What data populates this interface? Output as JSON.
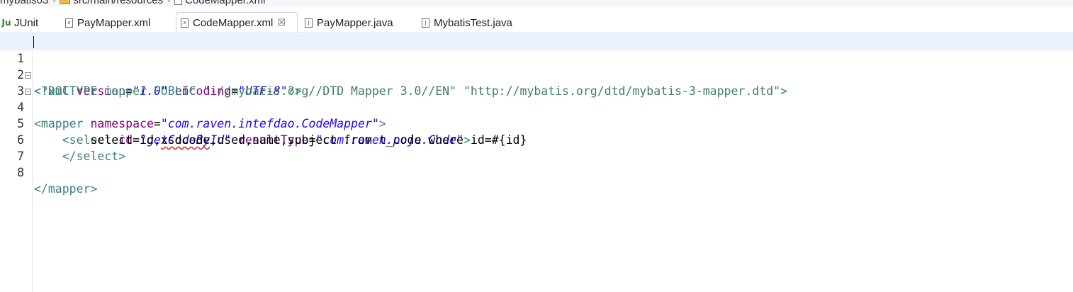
{
  "breadcrumb": {
    "items": [
      "mybatis03",
      "src/main/resources",
      "CodeMapper.xml"
    ]
  },
  "tabs": [
    {
      "label": "JUnit",
      "icon": "junit-icon",
      "active": false
    },
    {
      "label": "PayMapper.xml",
      "icon": "xml-file-icon",
      "active": false
    },
    {
      "label": "CodeMapper.xml",
      "icon": "xml-file-icon",
      "active": true,
      "close": "☒"
    },
    {
      "label": "PayMapper.java",
      "icon": "java-file-icon",
      "active": false
    },
    {
      "label": "MybatisTest.java",
      "icon": "java-file-icon",
      "active": false
    }
  ],
  "icon_glyphs": {
    "xml": "x",
    "java": "J",
    "junit": "Ju"
  },
  "editor": {
    "line_numbers": [
      "1",
      "2",
      "3",
      "4",
      "5",
      "6",
      "7",
      "8"
    ],
    "lines": {
      "l1": {
        "p1": "<?xml ",
        "p2": "version",
        "p3": "=",
        "p4": "\"1.0\"",
        "p5": " ",
        "p6": "encoding",
        "p7": "=",
        "p8": "\"UTF-8\"",
        "p9": "?>"
      },
      "l2": {
        "p1": "<!DOCTYPE mapper PUBLIC ",
        "p2": "\"-//mybatis.org//DTD Mapper 3.0//EN\"",
        "p3": " ",
        "p4": "\"http://mybatis.org/dtd/mybatis-3-mapper.dtd\"",
        "p5": ">"
      },
      "l3": {
        "p1": "<mapper ",
        "p2": "namespace",
        "p3": "=",
        "p4": "\"com.raven.intefdao.CodeMapper\"",
        "p5": ">"
      },
      "l4": {
        "p0": "    ",
        "p1": "<select ",
        "p2": "id",
        "p3": "=",
        "p4": "\"getCodeById\"",
        "p5": " ",
        "p6": "resultType",
        "p7": "=",
        "p8": "\"com.raven.pojo.Code\"",
        "p9": ">"
      },
      "l5": {
        "p1": "        select id,",
        "p2": "xsdcode",
        "p3": ",used,name,subject from t_code where id=#{id}"
      },
      "l6": {
        "p0": "    ",
        "p1": "</select>"
      },
      "l7": {
        "p1": ""
      },
      "l8": {
        "p1": "</mapper>"
      }
    },
    "fold_markers": {
      "l3": "⊖",
      "l4": "⊖"
    }
  },
  "colors": {
    "tag": "#3f7f7f",
    "attribute": "#7f007f",
    "string": "#2a00ff",
    "doctype_string": "#3f7f5f",
    "current_line": "#e8f2fe"
  }
}
